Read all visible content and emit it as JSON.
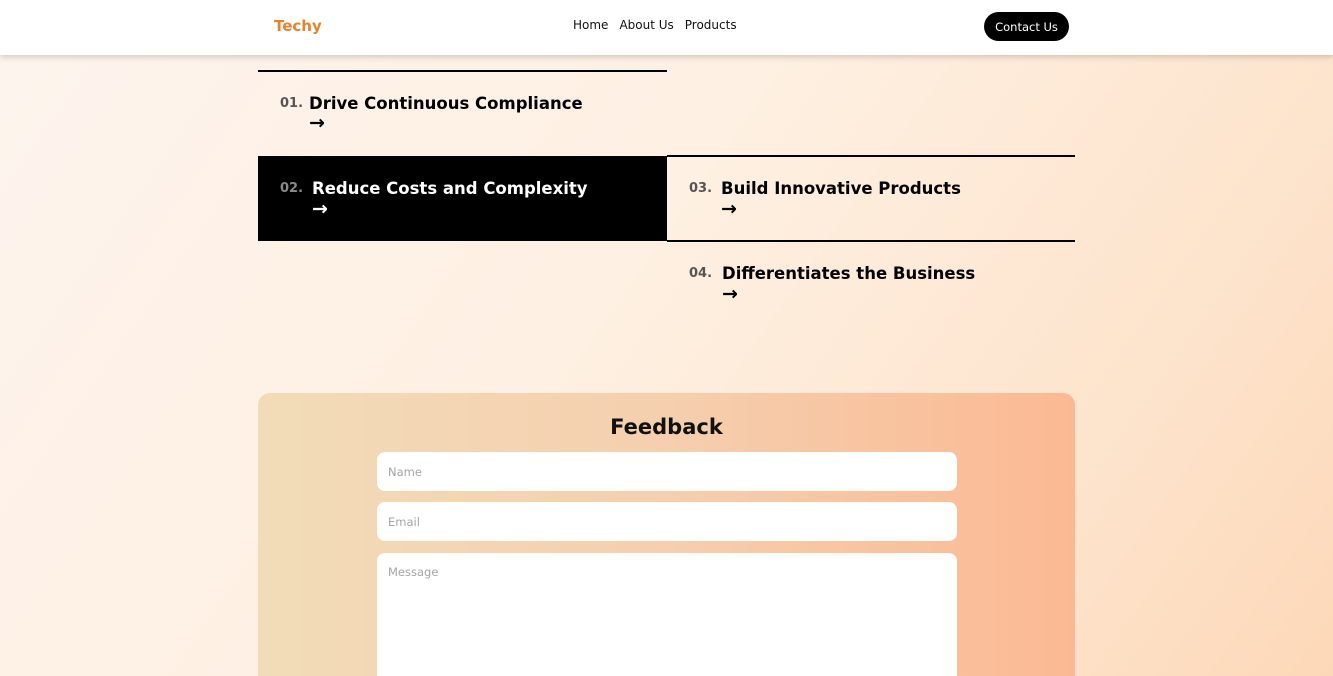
{
  "header": {
    "brand": "Techy",
    "nav": [
      "Home",
      "About Us",
      "Products"
    ],
    "contact_label": "Contact Us"
  },
  "benefits": [
    {
      "num": "01.",
      "title": "Drive Continuous Compliance",
      "arrow": "→",
      "active": false
    },
    {
      "num": "02.",
      "title": "Reduce Costs and Complexity",
      "arrow": "→",
      "active": true
    },
    {
      "num": "03.",
      "title": "Build Innovative Products",
      "arrow": "→",
      "active": false
    },
    {
      "num": "04.",
      "title": "Differentiates the Business",
      "arrow": "→",
      "active": false
    }
  ],
  "feedback": {
    "title": "Feedback",
    "name_placeholder": "Name",
    "email_placeholder": "Email",
    "message_placeholder": "Message"
  },
  "colors": {
    "brand": "#e8822a",
    "active_card": "#000000",
    "button": "#000000"
  }
}
